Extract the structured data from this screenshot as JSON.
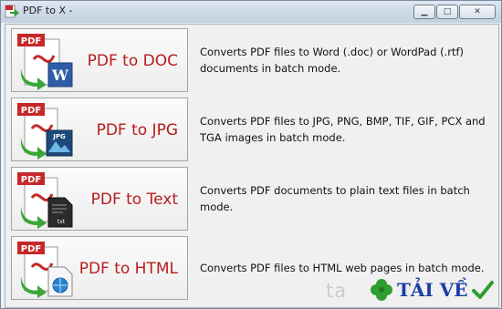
{
  "window": {
    "title": "PDF to X -",
    "buttons": {
      "minimize": "▁",
      "maximize": "□",
      "close": "✕"
    }
  },
  "rows": [
    {
      "label": "PDF to DOC",
      "description": "Converts PDF files to Word (.doc) or WordPad (.rtf) documents in batch mode.",
      "icon": "pdf-to-doc-icon",
      "badge": "PDF",
      "target_badge": "W"
    },
    {
      "label": "PDF to JPG",
      "description": "Converts PDF files to JPG, PNG, BMP, TIF, GIF, PCX and TGA images in batch mode.",
      "icon": "pdf-to-jpg-icon",
      "badge": "PDF",
      "target_badge": "JPG"
    },
    {
      "label": "PDF to Text",
      "description": "Converts PDF documents to plain text files in batch mode.",
      "icon": "pdf-to-text-icon",
      "badge": "PDF",
      "target_badge": "txt"
    },
    {
      "label": "PDF to HTML",
      "description": "Converts PDF files to HTML web pages in batch mode.",
      "icon": "pdf-to-html-icon",
      "badge": "PDF",
      "target_badge": ""
    }
  ],
  "watermark": {
    "prefix": "ta",
    "text": "TẢI VỀ"
  },
  "colors": {
    "label_red": "#b71c1c",
    "pdf_red": "#c62828",
    "arrow_green": "#3aa63a"
  }
}
